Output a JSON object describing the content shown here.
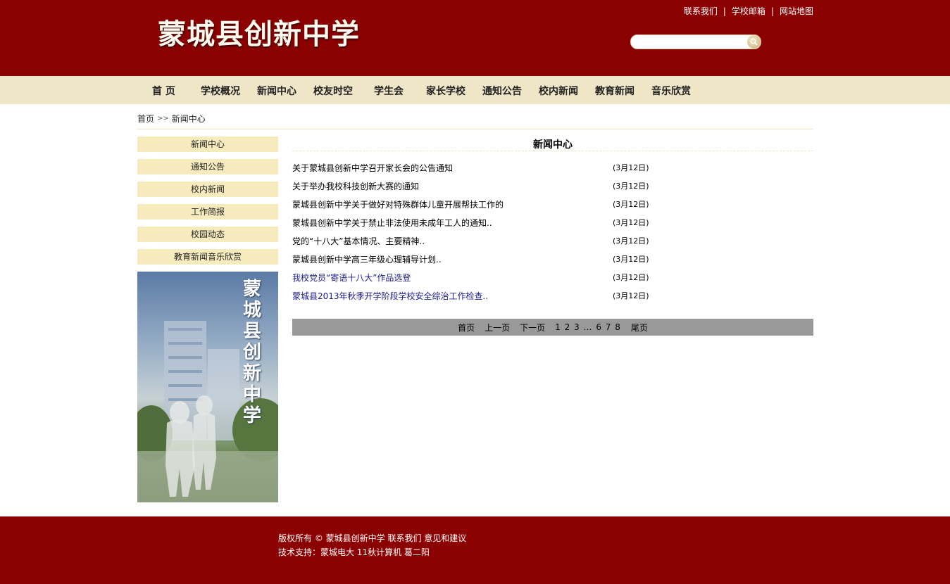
{
  "header": {
    "logo": "蒙城县创新中学",
    "toplinks": [
      "联系我们",
      "学校邮箱",
      "网站地图"
    ],
    "search": {
      "placeholder": ""
    }
  },
  "nav": [
    "首 页",
    "学校概况",
    "新闻中心",
    "校友时空",
    "学生会",
    "家长学校",
    "通知公告",
    "校内新闻",
    "教育新闻",
    "音乐欣赏"
  ],
  "breadcrumb": {
    "home": "首页",
    "separator": ">>",
    "current": "新闻中心"
  },
  "sidebar": {
    "items": [
      "新闻中心",
      "通知公告",
      "校内新闻",
      "工作简报",
      "校园动态",
      "教育新闻音乐欣赏"
    ],
    "banner_text": [
      "蒙",
      "城",
      "县",
      "创",
      "新",
      "中",
      "学"
    ]
  },
  "content": {
    "title": "新闻中心",
    "news": [
      {
        "title": "关于蒙城县创新中学召开家长会的公告通知",
        "date": "(3月12日)",
        "visited": false
      },
      {
        "title": "关于举办我校科技创新大赛的通知",
        "date": "(3月12日)",
        "visited": false
      },
      {
        "title": "蒙城县创新中学关于做好对特殊群体儿童开展帮扶工作的",
        "date": "(3月12日)",
        "visited": false
      },
      {
        "title": "蒙城县创新中学关于禁止非法使用未成年工人的通知..",
        "date": "(3月12日)",
        "visited": false
      },
      {
        "title": "党的“十八大”基本情况、主要精神..",
        "date": "(3月12日)",
        "visited": false
      },
      {
        "title": "蒙城县创新中学高三年级心理辅导计划..",
        "date": "(3月12日)",
        "visited": false
      },
      {
        "title": "我校党员“寄语十八大”作品选登",
        "date": "(3月12日)",
        "visited": true
      },
      {
        "title": "蒙城县2013年秋季开学阶段学校安全综治工作检查..",
        "date": "(3月12日)",
        "visited": true
      }
    ],
    "pager": {
      "first": "首页",
      "prev": "上一页",
      "next": "下一页",
      "pages": "1 2 3 … 6 7 8",
      "last": "尾页"
    }
  },
  "footer": {
    "line1": "版权所有 © 蒙城县创新中学 联系我们 意见和建议",
    "line2": "技术支持：蒙城电大 11秋计算机 葛二阳"
  },
  "colors": {
    "primary": "#8b0000",
    "nav_bg": "#efe5c7",
    "side_bg": "#f6ebbd",
    "pager_bg": "#999999"
  }
}
